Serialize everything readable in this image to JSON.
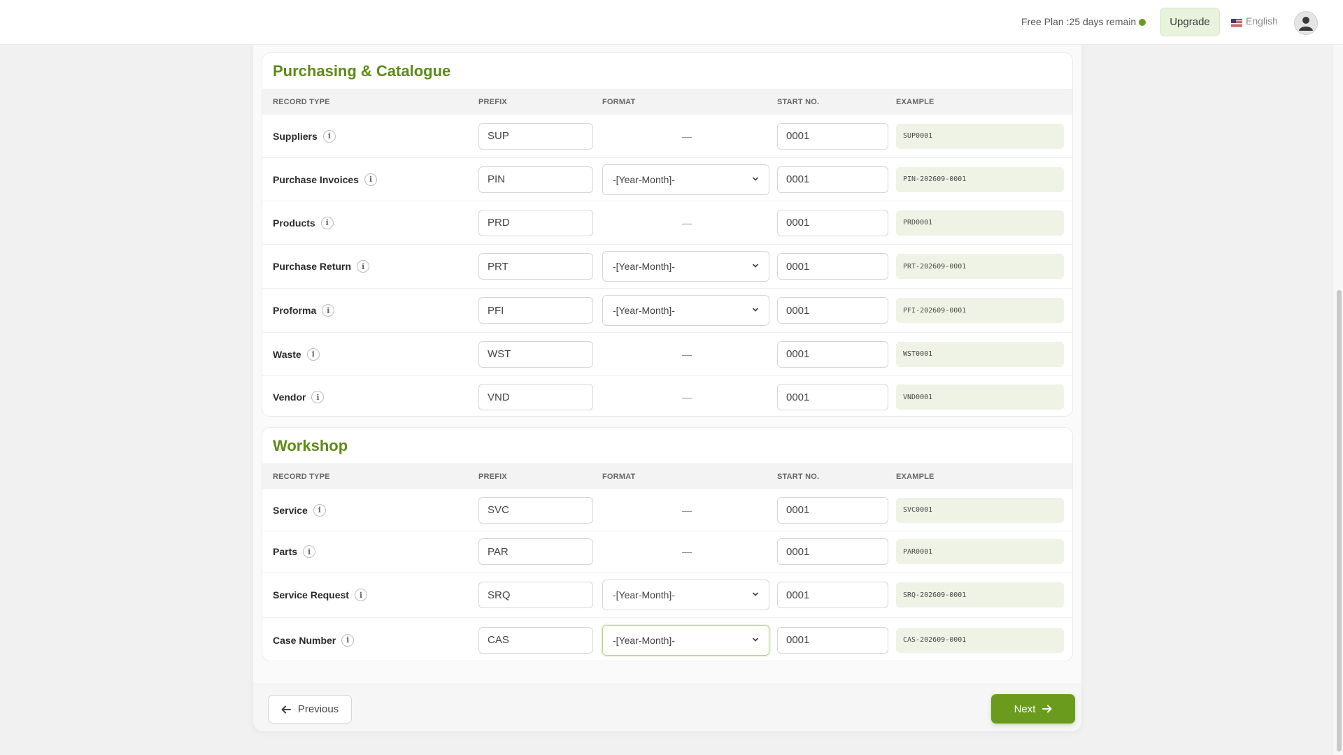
{
  "header": {
    "plan_text": "Free Plan :25 days remain",
    "upgrade_label": "Upgrade",
    "language_label": "English"
  },
  "columns": {
    "record_type": "RECORD TYPE",
    "prefix": "PREFIX",
    "format": "FORMAT",
    "start_no": "START NO.",
    "example": "EXAMPLE"
  },
  "sections": [
    {
      "title": "Purchasing & Catalogue",
      "rows": [
        {
          "label": "Suppliers",
          "prefix": "SUP",
          "format": "—",
          "start": "0001",
          "example": "SUP0001"
        },
        {
          "label": "Purchase Invoices",
          "prefix": "PIN",
          "format": "-[Year-Month]-",
          "start": "0001",
          "example": "PIN-202609-0001"
        },
        {
          "label": "Products",
          "prefix": "PRD",
          "format": "—",
          "start": "0001",
          "example": "PRD0001"
        },
        {
          "label": "Purchase Return",
          "prefix": "PRT",
          "format": "-[Year-Month]-",
          "start": "0001",
          "example": "PRT-202609-0001"
        },
        {
          "label": "Proforma",
          "prefix": "PFI",
          "format": "-[Year-Month]-",
          "start": "0001",
          "example": "PFI-202609-0001"
        },
        {
          "label": "Waste",
          "prefix": "WST",
          "format": "—",
          "start": "0001",
          "example": "WST0001"
        },
        {
          "label": "Vendor",
          "prefix": "VND",
          "format": "—",
          "start": "0001",
          "example": "VND0001"
        }
      ]
    },
    {
      "title": "Workshop",
      "rows": [
        {
          "label": "Service",
          "prefix": "SVC",
          "format": "—",
          "start": "0001",
          "example": "SVC0001"
        },
        {
          "label": "Parts",
          "prefix": "PAR",
          "format": "—",
          "start": "0001",
          "example": "PAR0001"
        },
        {
          "label": "Service Request",
          "prefix": "SRQ",
          "format": "-[Year-Month]-",
          "start": "0001",
          "example": "SRQ-202609-0001"
        },
        {
          "label": "Case Number",
          "prefix": "CAS",
          "format": "-[Year-Month]-",
          "start": "0001",
          "example": "CAS-202609-0001"
        }
      ]
    }
  ],
  "footer": {
    "previous_label": "Previous",
    "next_label": "Next"
  },
  "colors": {
    "accent": "#6a9b1d",
    "title_green": "#5e8a17",
    "example_bg": "#eef3e6"
  }
}
